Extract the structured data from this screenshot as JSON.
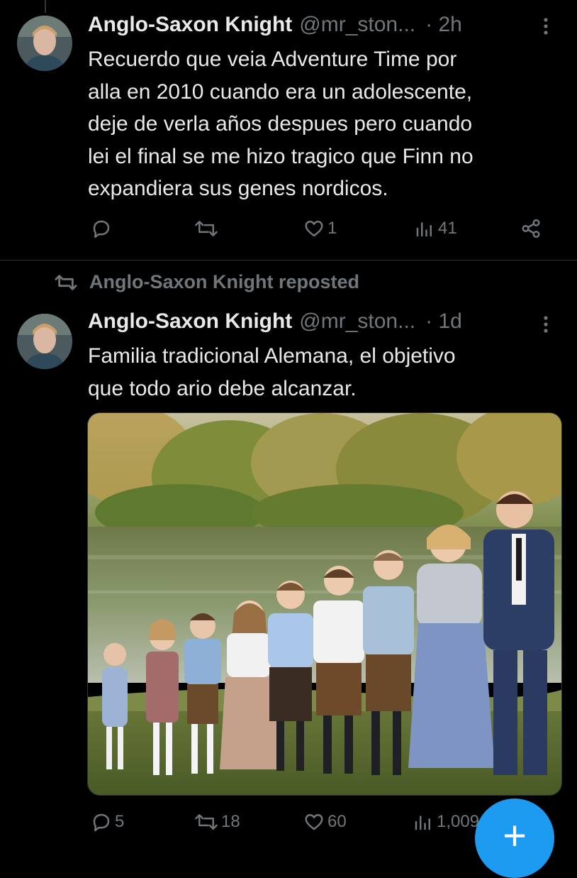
{
  "colors": {
    "background": "#000000",
    "text": "#e7e9ea",
    "muted": "#71767b",
    "accent": "#1d9bf0"
  },
  "tweet1": {
    "author": {
      "name": "Anglo-Saxon Knight",
      "handle": "@mr_ston...",
      "time": "· 2h",
      "avatar_icon": "user-avatar"
    },
    "text": "Recuerdo que veia Adventure Time por\nalla en 2010 cuando era un adolescente,\ndeje de verla años despues pero cuando\nlei el final se me hizo tragico que Finn no\nexpandiera sus genes nordicos.",
    "actions": {
      "replies": "",
      "reposts": "",
      "likes": "1",
      "views": "41"
    }
  },
  "repost_banner": {
    "text": "Anglo-Saxon Knight reposted",
    "icon": "repost-icon"
  },
  "tweet2": {
    "author": {
      "name": "Anglo-Saxon Knight",
      "handle": "@mr_ston...",
      "time": "· 1d",
      "avatar_icon": "user-avatar"
    },
    "text": "Familia tradicional Alemana, el objetivo\nque todo ario debe alcanzar.",
    "media": {
      "type": "photo",
      "description_icon": "family-photo"
    },
    "actions": {
      "replies": "5",
      "reposts": "18",
      "likes": "60",
      "views": "1,009"
    }
  },
  "compose_button": {
    "icon": "plus-icon",
    "label": "+"
  }
}
